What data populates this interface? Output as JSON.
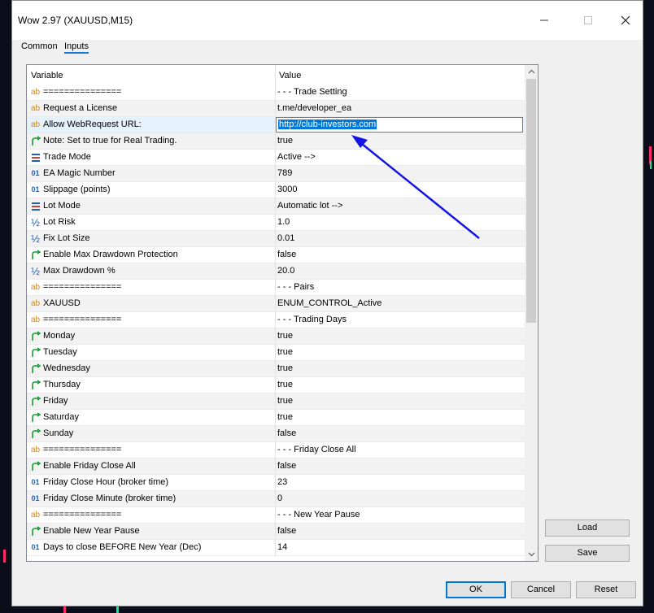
{
  "window": {
    "title": "Wow 2.97 (XAUUSD,M15)"
  },
  "tabs": [
    {
      "label": "Common",
      "active": false
    },
    {
      "label": "Inputs",
      "active": true
    }
  ],
  "grid": {
    "columns": {
      "variable": "Variable",
      "value": "Value"
    },
    "rows": [
      {
        "icon": "string-icon",
        "variable": "===============",
        "value": "- - - Trade Setting"
      },
      {
        "icon": "string-icon",
        "variable": "Request a License",
        "value": "t.me/developer_ea"
      },
      {
        "icon": "string-icon",
        "variable": "Allow WebRequest URL:",
        "value": "http://club-investors.com",
        "editing": true
      },
      {
        "icon": "bool-icon",
        "variable": "Note: Set to true for Real Trading.",
        "value": "true"
      },
      {
        "icon": "enum-icon",
        "variable": "Trade Mode",
        "value": "Active -->"
      },
      {
        "icon": "int-icon",
        "variable": "EA Magic Number",
        "value": "789"
      },
      {
        "icon": "int-icon",
        "variable": "Slippage (points)",
        "value": "3000"
      },
      {
        "icon": "enum-icon",
        "variable": "Lot Mode",
        "value": "Automatic lot -->"
      },
      {
        "icon": "double-icon",
        "variable": "Lot Risk",
        "value": "1.0"
      },
      {
        "icon": "double-icon",
        "variable": "Fix Lot Size",
        "value": "0.01"
      },
      {
        "icon": "bool-icon",
        "variable": "Enable Max Drawdown Protection",
        "value": "false"
      },
      {
        "icon": "double-icon",
        "variable": "Max Drawdown %",
        "value": "20.0"
      },
      {
        "icon": "string-icon",
        "variable": "===============",
        "value": "- - - Pairs"
      },
      {
        "icon": "string-icon",
        "variable": "XAUUSD",
        "value": "ENUM_CONTROL_Active"
      },
      {
        "icon": "string-icon",
        "variable": "===============",
        "value": "- - - Trading Days"
      },
      {
        "icon": "bool-icon",
        "variable": "Monday",
        "value": "true"
      },
      {
        "icon": "bool-icon",
        "variable": "Tuesday",
        "value": "true"
      },
      {
        "icon": "bool-icon",
        "variable": "Wednesday",
        "value": "true"
      },
      {
        "icon": "bool-icon",
        "variable": "Thursday",
        "value": "true"
      },
      {
        "icon": "bool-icon",
        "variable": "Friday",
        "value": "true"
      },
      {
        "icon": "bool-icon",
        "variable": "Saturday",
        "value": "true"
      },
      {
        "icon": "bool-icon",
        "variable": "Sunday",
        "value": "false"
      },
      {
        "icon": "string-icon",
        "variable": "===============",
        "value": "- - - Friday Close All"
      },
      {
        "icon": "bool-icon",
        "variable": "Enable Friday Close All",
        "value": "false"
      },
      {
        "icon": "int-icon",
        "variable": "Friday Close Hour (broker time)",
        "value": "23"
      },
      {
        "icon": "int-icon",
        "variable": "Friday Close Minute (broker time)",
        "value": "0"
      },
      {
        "icon": "string-icon",
        "variable": "===============",
        "value": "- - - New Year Pause"
      },
      {
        "icon": "bool-icon",
        "variable": "Enable New Year Pause",
        "value": "false"
      },
      {
        "icon": "int-icon",
        "variable": "Days to close BEFORE New Year (Dec)",
        "value": "14"
      }
    ]
  },
  "icon_glyphs": {
    "string-icon": "ab",
    "int-icon": "01",
    "double-icon": "½",
    "bool-icon": "↱",
    "enum-icon": "☰"
  },
  "side_buttons": {
    "load": "Load",
    "save": "Save"
  },
  "footer_buttons": {
    "ok": "OK",
    "cancel": "Cancel",
    "reset": "Reset"
  },
  "colors": {
    "accent": "#0078d7",
    "annotation_arrow": "#1414e6",
    "bool_icon": "#1a9a3a",
    "string_icon": "#d2861e",
    "number_icon": "#1f5fb8"
  }
}
